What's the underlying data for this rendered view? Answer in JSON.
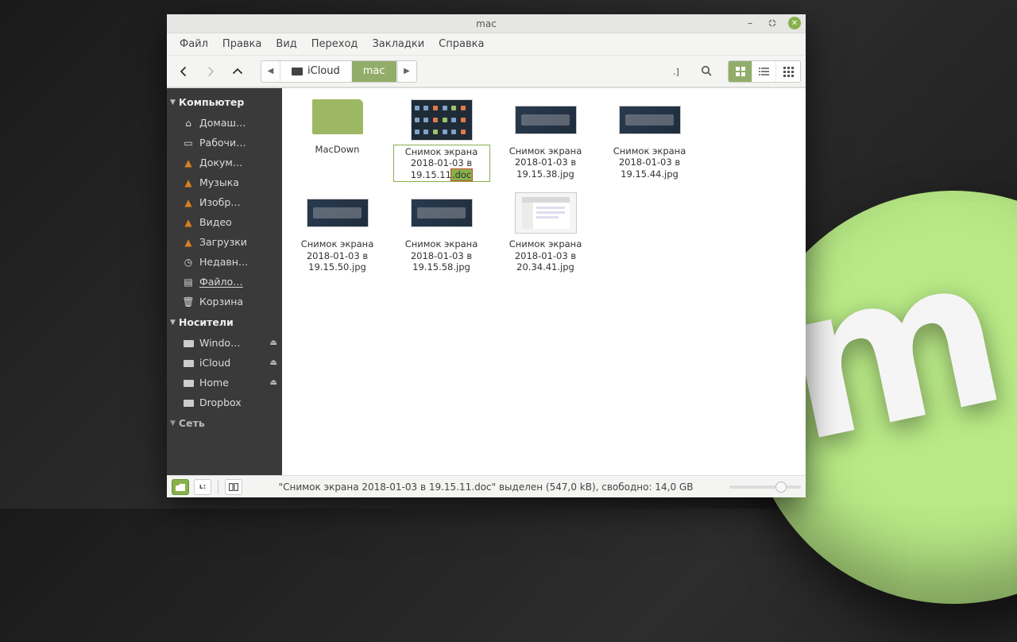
{
  "window": {
    "title": "mac"
  },
  "menubar": [
    "Файл",
    "Правка",
    "Вид",
    "Переход",
    "Закладки",
    "Справка"
  ],
  "breadcrumb": {
    "parent": "iCloud",
    "current": "mac"
  },
  "sidebar": {
    "sections": [
      {
        "title": "Компьютер",
        "items": [
          {
            "icon": "home",
            "label": "Домаш…"
          },
          {
            "icon": "desktop",
            "label": "Рабочи…"
          },
          {
            "icon": "folder",
            "label": "Докум…"
          },
          {
            "icon": "folder",
            "label": "Музыка"
          },
          {
            "icon": "folder",
            "label": "Изобр…"
          },
          {
            "icon": "folder",
            "label": "Видео"
          },
          {
            "icon": "folder",
            "label": "Загрузки"
          },
          {
            "icon": "clock",
            "label": "Недавн…"
          },
          {
            "icon": "file",
            "label": "Файло…",
            "underline": true
          },
          {
            "icon": "trash",
            "label": "Корзина"
          }
        ]
      },
      {
        "title": "Носители",
        "items": [
          {
            "icon": "drive",
            "label": "Windo…",
            "eject": true
          },
          {
            "icon": "drive",
            "label": "iCloud",
            "eject": true
          },
          {
            "icon": "drive",
            "label": "Home",
            "eject": true
          },
          {
            "icon": "drive",
            "label": "Dropbox"
          }
        ]
      },
      {
        "title": "Сеть",
        "items": []
      }
    ]
  },
  "files": [
    {
      "type": "folder",
      "name": "MacDown",
      "selected": false
    },
    {
      "type": "image-grid",
      "name_base": "Снимок экрана 2018-01-03 в 19.15.11",
      "ext": ".doc",
      "selected": true
    },
    {
      "type": "image-bar",
      "name": "Снимок экрана 2018-01-03 в 19.15.38.jpg"
    },
    {
      "type": "image-bar",
      "name": "Снимок экрана 2018-01-03 в 19.15.44.jpg"
    },
    {
      "type": "image-bar",
      "name": "Снимок экрана 2018-01-03 в 19.15.50.jpg"
    },
    {
      "type": "image-bar",
      "name": "Снимок экрана 2018-01-03 в 19.15.58.jpg"
    },
    {
      "type": "image-win",
      "name": "Снимок экрана 2018-01-03 в 20.34.41.jpg"
    }
  ],
  "status": {
    "text": "\"Снимок экрана 2018-01-03 в 19.15.11.doc\" выделен (547,0 kB), свободно: 14,0 GB"
  }
}
